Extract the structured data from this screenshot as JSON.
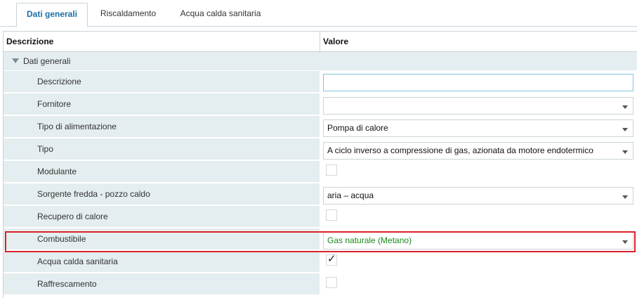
{
  "tabs": [
    {
      "label": "Dati generali",
      "active": true
    },
    {
      "label": "Riscaldamento",
      "active": false
    },
    {
      "label": "Acqua calda sanitaria",
      "active": false
    }
  ],
  "grid": {
    "header": {
      "description": "Descrizione",
      "value": "Valore"
    },
    "group_label": "Dati generali",
    "rows": {
      "descrizione": {
        "label": "Descrizione",
        "value": ""
      },
      "fornitore": {
        "label": "Fornitore",
        "value": ""
      },
      "tipo_alimentazione": {
        "label": "Tipo di alimentazione",
        "value": "Pompa di calore"
      },
      "tipo": {
        "label": "Tipo",
        "value": "A ciclo inverso a compressione di gas, azionata da motore endotermico"
      },
      "modulante": {
        "label": "Modulante",
        "checked": false
      },
      "sorgente": {
        "label": "Sorgente fredda - pozzo caldo",
        "value": "aria – acqua"
      },
      "recupero": {
        "label": "Recupero di calore",
        "checked": false
      },
      "combustibile": {
        "label": "Combustibile",
        "value": "Gas naturale (Metano)"
      },
      "acqua_calda": {
        "label": "Acqua calda sanitaria",
        "checked": true
      },
      "raffrescamento": {
        "label": "Raffrescamento",
        "checked": false
      }
    }
  },
  "colors": {
    "accent_tab": "#1a6ea8",
    "row_bg": "#e4edef",
    "highlight": "#d9232b",
    "combustibile_text": "#1b8a1b"
  },
  "icons": {
    "group_toggle": "triangle-down-icon",
    "dropdown": "chevron-down-icon",
    "checkmark": "checkmark-icon"
  }
}
